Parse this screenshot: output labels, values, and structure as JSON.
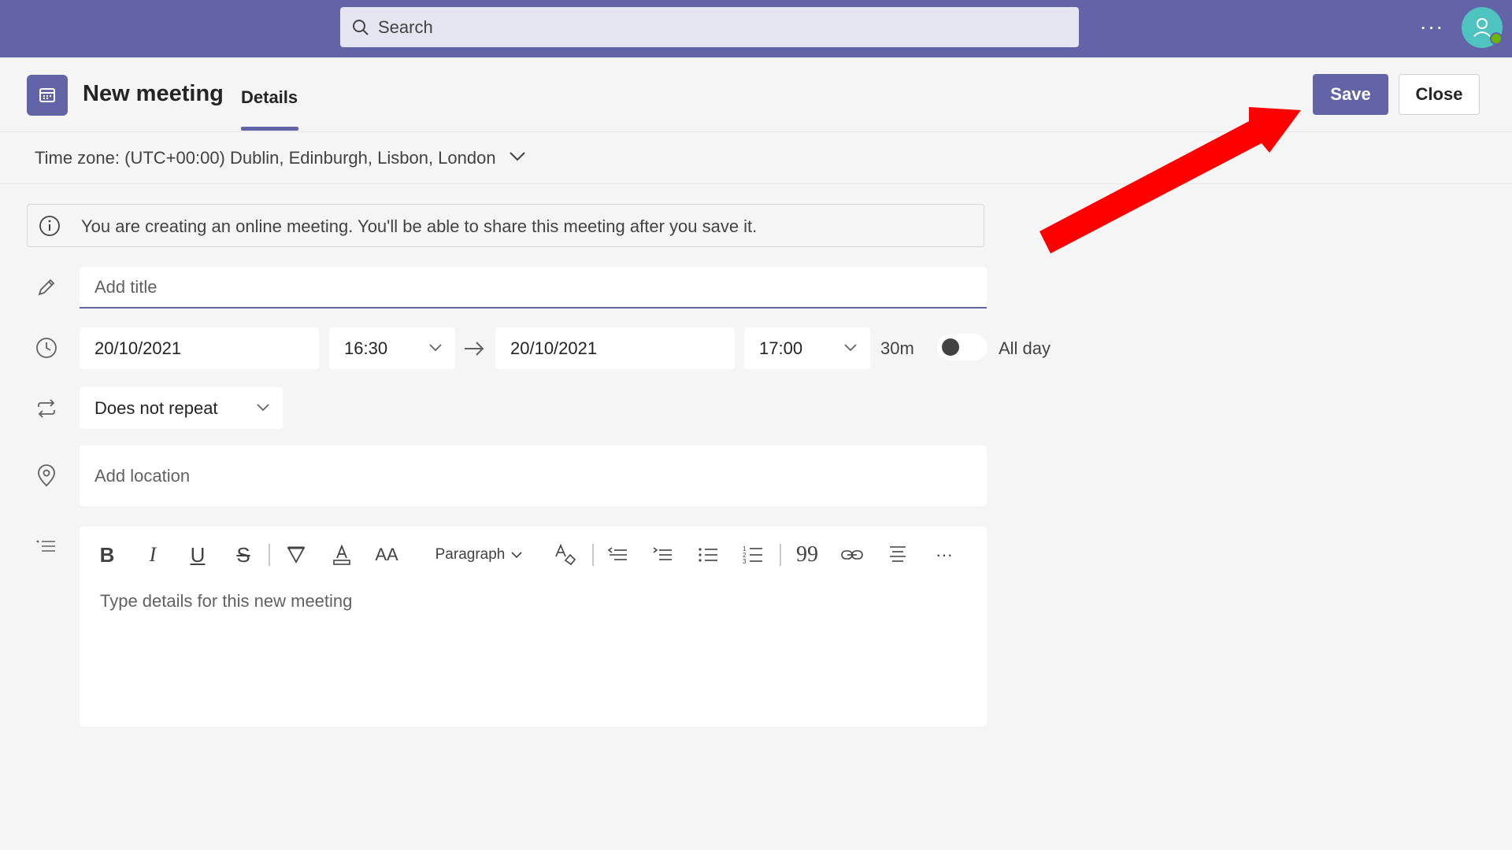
{
  "topbar": {
    "search_placeholder": "Search",
    "more_label": "···"
  },
  "header": {
    "title": "New meeting",
    "tab_details": "Details",
    "save_label": "Save",
    "close_label": "Close"
  },
  "timezone": {
    "label": "Time zone: (UTC+00:00) Dublin, Edinburgh, Lisbon, London"
  },
  "banner": {
    "text": "You are creating an online meeting. You'll be able to share this meeting after you save it."
  },
  "form": {
    "title_placeholder": "Add title",
    "start_date": "20/10/2021",
    "start_time": "16:30",
    "end_date": "20/10/2021",
    "end_time": "17:00",
    "duration": "30m",
    "all_day_label": "All day",
    "all_day_on": false,
    "repeat": "Does not repeat",
    "location_placeholder": "Add location"
  },
  "editor": {
    "paragraph_label": "Paragraph",
    "placeholder": "Type details for this new meeting",
    "more_label": "···"
  },
  "colors": {
    "brand": "#6264a7",
    "annotation_arrow": "#ff0000",
    "avatar": "#4fc3c0",
    "presence": "#6bb700"
  }
}
